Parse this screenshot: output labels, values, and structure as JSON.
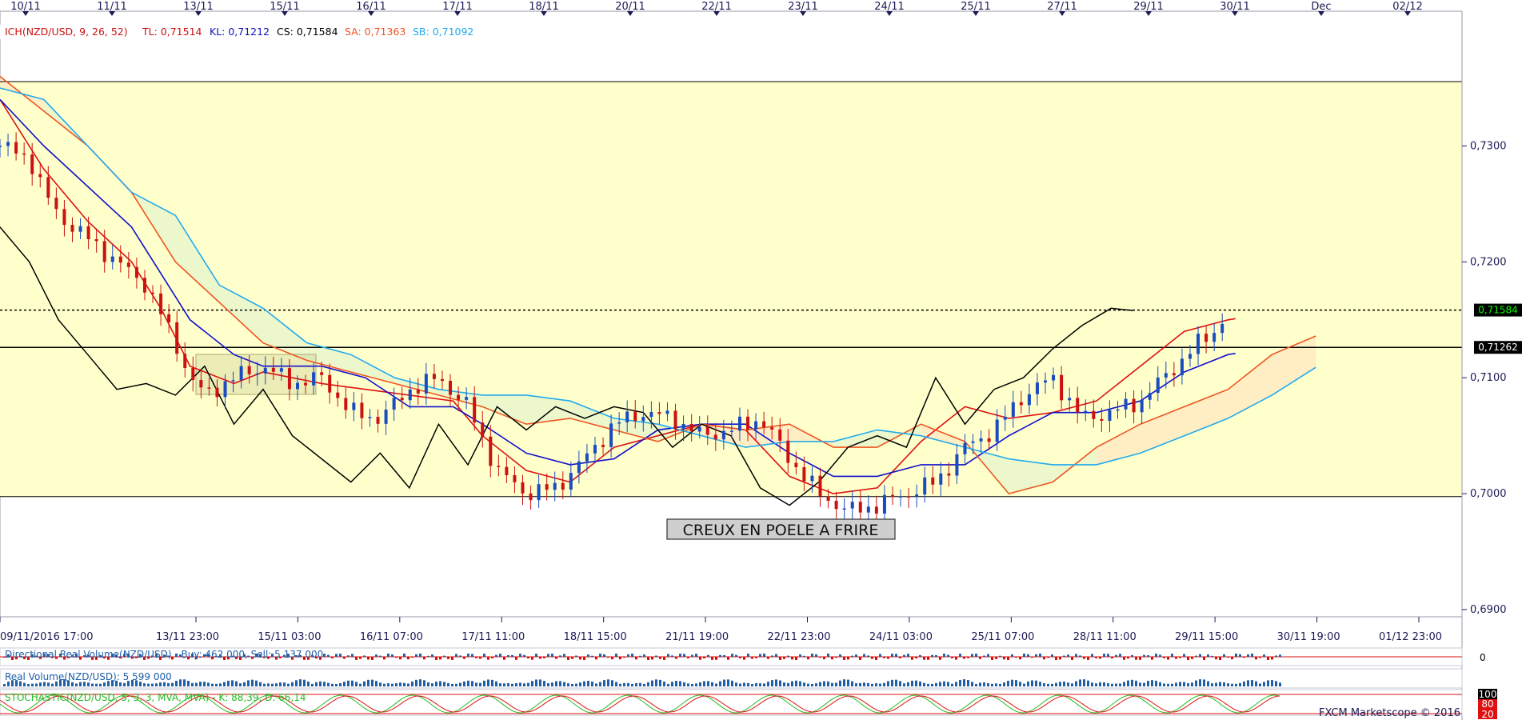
{
  "chart_data": {
    "type": "line",
    "instrument": "NZD/USD",
    "top_date_labels": [
      "10/11",
      "11/11",
      "13/11",
      "15/11",
      "16/11",
      "17/11",
      "18/11",
      "20/11",
      "22/11",
      "23/11",
      "24/11",
      "25/11",
      "27/11",
      "29/11",
      "30/11",
      "Dec",
      "02/12"
    ],
    "bottom_time_labels": [
      "09/11/2016 17:00",
      "13/11 23:00",
      "15/11 03:00",
      "16/11 07:00",
      "17/11 11:00",
      "18/11 15:00",
      "21/11 19:00",
      "22/11 23:00",
      "24/11 03:00",
      "25/11 07:00",
      "28/11 11:00",
      "29/11 15:00",
      "30/11 19:00",
      "01/12 23:00"
    ],
    "y_ticks": [
      "0,7300",
      "0,7200",
      "0,7100",
      "0,7000",
      "0,6900"
    ],
    "ylim": [
      0.69,
      0.739
    ],
    "x_range": [
      0,
      100
    ],
    "x_projection_end": 86,
    "indicator_legend": {
      "ich": "ICH(NZD/USD, 9, 26, 52)",
      "tl": "TL: 0,71514",
      "kl": "KL: 0,71212",
      "cs": "CS: 0,71584",
      "sa": "SA: 0,71363",
      "sb": "SB: 0,71092"
    },
    "current_price_label": "0,71584",
    "current_price": 0.71584,
    "hline_label": "0,71262",
    "hline_value": 0.71262,
    "support_line": 0.69975,
    "resistance_line": 0.73555,
    "annotation": "CREUX EN POELE A FRIRE",
    "series": [
      {
        "name": "Tenkan",
        "color": "#dd1111",
        "x": [
          0,
          3,
          6,
          9,
          11,
          13,
          16,
          18,
          20,
          22,
          25,
          28,
          31,
          33,
          36,
          39,
          42,
          45,
          48,
          51,
          54,
          57,
          60,
          63,
          66,
          69,
          72,
          75,
          78,
          81,
          84,
          84.5
        ],
        "y": [
          0.734,
          0.728,
          0.7235,
          0.72,
          0.716,
          0.711,
          0.7095,
          0.7105,
          0.71,
          0.7095,
          0.709,
          0.7085,
          0.708,
          0.705,
          0.702,
          0.701,
          0.704,
          0.705,
          0.706,
          0.7055,
          0.7015,
          0.7,
          0.7005,
          0.7045,
          0.7075,
          0.7065,
          0.707,
          0.708,
          0.711,
          0.714,
          0.715,
          0.7151
        ]
      },
      {
        "name": "Kijun",
        "color": "#1111cc",
        "x": [
          0,
          3,
          6,
          9,
          11,
          13,
          16,
          18,
          20,
          22,
          25,
          28,
          31,
          33,
          36,
          39,
          42,
          45,
          48,
          51,
          54,
          57,
          60,
          63,
          66,
          69,
          72,
          75,
          78,
          81,
          84,
          84.5
        ],
        "y": [
          0.734,
          0.73,
          0.7265,
          0.723,
          0.719,
          0.715,
          0.712,
          0.711,
          0.711,
          0.711,
          0.71,
          0.7075,
          0.7075,
          0.706,
          0.7035,
          0.7025,
          0.703,
          0.7055,
          0.706,
          0.706,
          0.7035,
          0.7015,
          0.7015,
          0.7025,
          0.7025,
          0.705,
          0.707,
          0.707,
          0.708,
          0.7105,
          0.712,
          0.7121
        ]
      },
      {
        "name": "Senkou A",
        "color": "#ee5522",
        "x": [
          0,
          3,
          6,
          9,
          12,
          15,
          18,
          21,
          24,
          27,
          30,
          33,
          36,
          39,
          42,
          45,
          48,
          51,
          54,
          57,
          60,
          63,
          66,
          69,
          72,
          75,
          78,
          81,
          84,
          87,
          90
        ],
        "y": [
          0.736,
          0.733,
          0.73,
          0.726,
          0.72,
          0.7165,
          0.713,
          0.7115,
          0.7105,
          0.7095,
          0.7085,
          0.7075,
          0.706,
          0.7065,
          0.7055,
          0.7045,
          0.706,
          0.7055,
          0.706,
          0.704,
          0.704,
          0.706,
          0.7045,
          0.7,
          0.701,
          0.704,
          0.706,
          0.7075,
          0.709,
          0.712,
          0.7136
        ]
      },
      {
        "name": "Senkou B",
        "color": "#22aaee",
        "x": [
          0,
          3,
          6,
          9,
          12,
          15,
          18,
          21,
          24,
          27,
          30,
          33,
          36,
          39,
          42,
          45,
          48,
          51,
          54,
          57,
          60,
          63,
          66,
          69,
          72,
          75,
          78,
          81,
          84,
          87,
          90
        ],
        "y": [
          0.735,
          0.734,
          0.73,
          0.726,
          0.724,
          0.718,
          0.716,
          0.713,
          0.712,
          0.71,
          0.709,
          0.7085,
          0.7085,
          0.708,
          0.7065,
          0.706,
          0.705,
          0.704,
          0.7045,
          0.7045,
          0.7055,
          0.705,
          0.704,
          0.703,
          0.7025,
          0.7025,
          0.7035,
          0.705,
          0.7065,
          0.7085,
          0.7109
        ]
      },
      {
        "name": "Chikou",
        "color": "#000000",
        "x": [
          0,
          2,
          4,
          6,
          8,
          10,
          12,
          14,
          16,
          18,
          20,
          21,
          22,
          24,
          26,
          28,
          30,
          32,
          34,
          36,
          38,
          40,
          42,
          44,
          46,
          48,
          50,
          52,
          54,
          56,
          58,
          60,
          62,
          64,
          66,
          68,
          70,
          72,
          74,
          76,
          77.5
        ],
        "y": [
          0.723,
          0.72,
          0.715,
          0.712,
          0.709,
          0.7095,
          0.7085,
          0.711,
          0.706,
          0.709,
          0.705,
          0.704,
          0.703,
          0.701,
          0.7035,
          0.7005,
          0.706,
          0.7025,
          0.7075,
          0.7055,
          0.7075,
          0.7065,
          0.7075,
          0.707,
          0.704,
          0.706,
          0.705,
          0.7005,
          0.699,
          0.701,
          0.704,
          0.705,
          0.704,
          0.71,
          0.706,
          0.709,
          0.71,
          0.7125,
          0.7145,
          0.716,
          0.7158
        ]
      },
      {
        "name": "Close",
        "color": "#1a4cc0",
        "x": [
          0,
          2,
          3,
          4,
          6,
          8,
          10,
          12,
          13,
          14,
          16,
          18,
          20,
          22,
          24,
          26,
          28,
          30,
          32,
          34,
          36,
          38,
          40,
          42,
          44,
          46,
          48,
          50,
          52,
          54,
          56,
          58,
          60,
          62,
          64,
          66,
          68,
          70,
          72,
          74,
          76,
          78,
          80,
          82,
          83,
          84
        ],
        "y": [
          0.73,
          0.729,
          0.726,
          0.724,
          0.722,
          0.72,
          0.718,
          0.713,
          0.71,
          0.7085,
          0.71,
          0.711,
          0.7095,
          0.71,
          0.707,
          0.7065,
          0.709,
          0.71,
          0.7075,
          0.702,
          0.7,
          0.7005,
          0.703,
          0.706,
          0.707,
          0.7065,
          0.705,
          0.7055,
          0.7065,
          0.703,
          0.7,
          0.6985,
          0.699,
          0.7,
          0.701,
          0.704,
          0.7055,
          0.7085,
          0.71,
          0.7065,
          0.707,
          0.708,
          0.7105,
          0.713,
          0.714,
          0.7155
        ]
      }
    ],
    "sub_panels": [
      {
        "label": "Directional Real Volume(NZD/USD) - Buy: 462 000, Sell: 5 137 000",
        "axis_label": "0"
      },
      {
        "label": "Real Volume(NZD/USD): 5 599 000"
      },
      {
        "label": "STOCHASTIC(NZD/USD, 5, 3, 3, MVA, MVA) - K: 88,39, D: 66,14",
        "levels": [
          "100",
          "80",
          "20"
        ]
      }
    ],
    "grid": false,
    "background_colors": {
      "pane": "#ffffcc",
      "cloud_bull": "#ffe8c0",
      "cloud_bear": "#e6f5cc"
    }
  },
  "copyright": "FXCM Marketscope © 2016"
}
